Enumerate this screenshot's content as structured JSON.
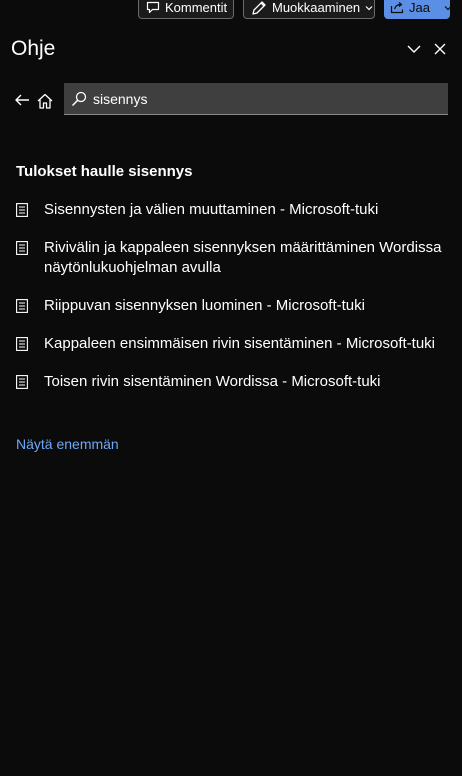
{
  "toolbar": {
    "comment_label": "Kommentit",
    "edit_label": "Muokkaaminen",
    "share_label": "Jaa"
  },
  "pane": {
    "title": "Ohje"
  },
  "search": {
    "value": "sisennys"
  },
  "results": {
    "heading": "Tulokset haulle sisennys",
    "items": [
      {
        "label": "Sisennysten ja välien muuttaminen - Microsoft-tuki"
      },
      {
        "label": "Rivivälin ja kappaleen sisennyksen määrittäminen Wordissa näytönlukuohjelman avulla"
      },
      {
        "label": "Riippuvan sisennyksen luominen - Microsoft-tuki"
      },
      {
        "label": "Kappaleen ensimmäisen rivin sisentäminen - Microsoft-tuki"
      },
      {
        "label": "Toisen rivin sisentäminen Wordissa - Microsoft-tuki"
      }
    ],
    "more_label": "Näytä enemmän"
  },
  "colors": {
    "background": "#0b0b0b",
    "accent": "#5b8fe6",
    "link": "#6ea8f7",
    "search_field": "#3f3f3f"
  },
  "icons": {
    "comment": "comment-icon",
    "edit": "pencil-icon",
    "share": "share-icon",
    "collapse": "chevron-down-icon",
    "close": "close-icon",
    "back": "back-arrow-icon",
    "home": "home-icon",
    "search": "search-icon",
    "result": "document-icon"
  }
}
